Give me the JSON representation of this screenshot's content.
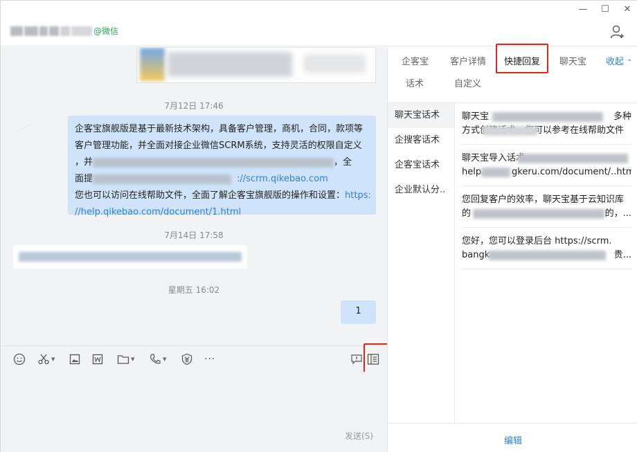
{
  "window_controls": {
    "minimize": "—",
    "maximize": "☐",
    "close": "✕"
  },
  "header": {
    "contact_suffix": "@微信"
  },
  "chat": {
    "messages": [
      {
        "type": "time",
        "text": "7月12日 17:46"
      },
      {
        "type": "text",
        "side": "right",
        "line1": "企客宝旗舰版是基于最新技术架构，具备客户管理，商机，合同，款项等",
        "line2": "客户管理功能，并全面对接企业微信SCRM系统，支持灵活的权限自定义",
        "line3_start": "，并",
        "line3_end": "，全",
        "line4_start": "面提",
        "line4_link": "://scrm.qikebao.com",
        "line5": "您也可以访问在线帮助文件，全面了解企客宝旗舰版的操作和设置：",
        "line5_link": "https:",
        "line6_link": "//help.qikebao.com/document/1.html"
      },
      {
        "type": "time",
        "text": "7月14日 17:58"
      },
      {
        "type": "time",
        "text": "星期五 16:02"
      },
      {
        "type": "text",
        "side": "right",
        "text": "1"
      }
    ]
  },
  "toolbar": {
    "icons": [
      "emoji-icon",
      "scissors-icon",
      "image-icon",
      "word-doc-icon",
      "folder-icon",
      "phone-icon",
      "payment-icon",
      "more-icon",
      "chat-bubble-icon",
      "quick-reply-panel-icon"
    ],
    "more": "···"
  },
  "input": {
    "send_label": "发送(S)"
  },
  "side": {
    "tabs": [
      "企客宝",
      "客户详情",
      "快捷回复",
      "聊天宝"
    ],
    "collapse_label": "收起",
    "sub_tabs": [
      "话术",
      "自定义"
    ],
    "categories": [
      "聊天宝话术",
      "企搜客话术",
      "企客宝话术",
      "企业默认分.."
    ],
    "replies": [
      {
        "line1_start": "聊天宝",
        "line1_end": "多种",
        "line2_start": "方式创建话术，您可以参考在线帮助文件",
        "line2_end": ""
      },
      {
        "line1_start": "聊天宝导入话术",
        "line1_end": "",
        "line2_start": "help.",
        "line2_end": "gkeru.com/document/..html"
      },
      {
        "line1_start": "您回复客户的效率，聊天宝基于云知识库",
        "line1_end": "",
        "line2_start": "的",
        "line2_end": "的，..."
      },
      {
        "line1_start": "您好，您可以登录后台 https://scrm.",
        "line1_end": "",
        "line2_start": "bangk",
        "line2_end": "贵..."
      }
    ],
    "edit_label": "编辑"
  },
  "accent_colors": {
    "link": "#2f7fd6",
    "highlight": "#e2241a",
    "wechat": "#31a353",
    "bubble": "#cfe4fb"
  }
}
